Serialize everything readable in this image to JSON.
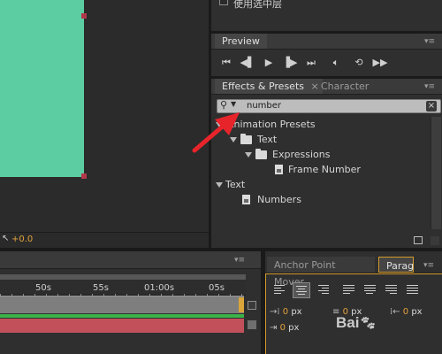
{
  "top_panel": {
    "checkbox_label": "使用选中层"
  },
  "preview": {
    "tab": "Preview",
    "menu_icon": "panel-menu-icon",
    "controls": [
      "first-frame",
      "prev-frame",
      "play",
      "next-frame",
      "last-frame",
      "audio",
      "loop",
      "ram-preview"
    ]
  },
  "effects": {
    "tabs": [
      "Effects & Presets",
      "Character"
    ],
    "close_glyph": "×",
    "search": {
      "value": "number",
      "clear_glyph": "×"
    },
    "tree": [
      {
        "label": "Animation Presets",
        "level": 0,
        "type": "group"
      },
      {
        "label": "Text",
        "level": 1,
        "type": "folder"
      },
      {
        "label": "Expressions",
        "level": 2,
        "type": "folder"
      },
      {
        "label": "Frame Number",
        "level": 3,
        "type": "preset"
      },
      {
        "label": "Text",
        "level": 0,
        "type": "group"
      },
      {
        "label": "Numbers",
        "level": 1,
        "type": "effect"
      }
    ]
  },
  "comp": {
    "solid_color": "#5ccda2",
    "exposure_value": "+0.0"
  },
  "timeline": {
    "ruler": [
      "50s",
      "55s",
      "01:00s",
      "05s"
    ],
    "track_green": "#3bb34a",
    "track_red": "#c2505a"
  },
  "bottom_right": {
    "tabs": [
      "Anchor Point Mover",
      "Parag"
    ],
    "fields": [
      {
        "value": "0",
        "unit": "px"
      },
      {
        "value": "0",
        "unit": "px"
      },
      {
        "value": "0",
        "unit": "px"
      },
      {
        "value": "0",
        "unit": "px"
      }
    ]
  },
  "watermark": "Bai"
}
